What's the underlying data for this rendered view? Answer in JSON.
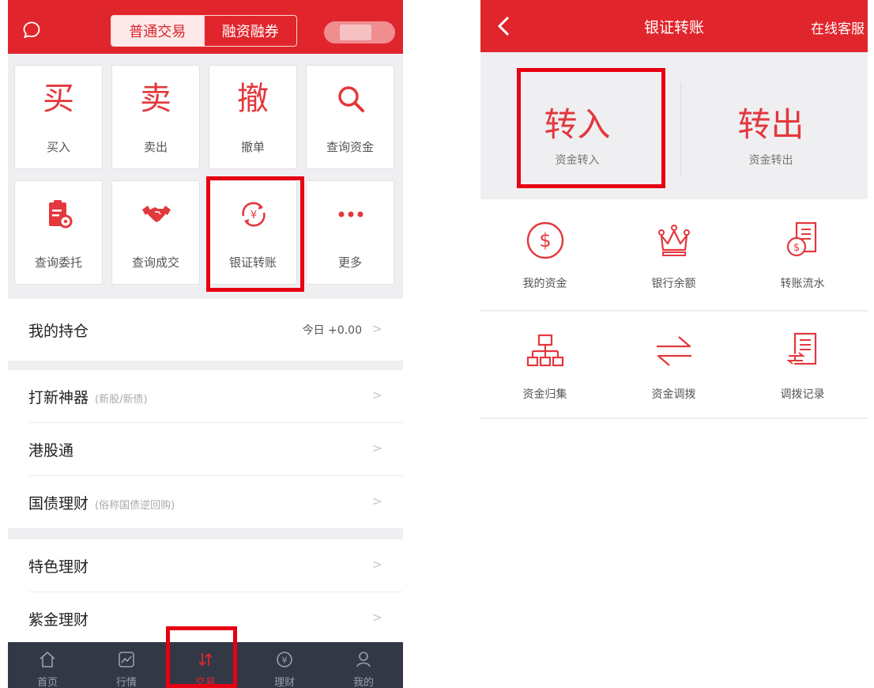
{
  "left": {
    "header": {
      "tabs": [
        "普通交易",
        "融资融券"
      ],
      "active_tab": 0
    },
    "grid": [
      {
        "glyph": "买",
        "label": "买入"
      },
      {
        "glyph": "卖",
        "label": "卖出"
      },
      {
        "glyph": "撤",
        "label": "撤单"
      },
      {
        "icon": "search-icon",
        "label": "查询资金"
      },
      {
        "icon": "clipboard-search-icon",
        "label": "查询委托"
      },
      {
        "icon": "handshake-icon",
        "label": "查询成交"
      },
      {
        "icon": "yuan-transfer-icon",
        "label": "银证转账"
      },
      {
        "icon": "more-dots-icon",
        "label": "更多"
      }
    ],
    "holdings": {
      "title": "我的持仓",
      "value": "今日 +0.00"
    },
    "list_group_1": [
      {
        "title": "打新神器",
        "subtitle": "(新股/新债)"
      },
      {
        "title": "港股通",
        "subtitle": ""
      },
      {
        "title": "国债理财",
        "subtitle": "(俗称国债逆回购)"
      }
    ],
    "list_group_2": [
      {
        "title": "特色理财"
      },
      {
        "title": "紫金理财"
      }
    ],
    "tabbar": [
      {
        "icon": "home-icon",
        "label": "首页"
      },
      {
        "icon": "chart-icon",
        "label": "行情"
      },
      {
        "icon": "trade-arrows-icon",
        "label": "交易"
      },
      {
        "icon": "yuan-circle-icon",
        "label": "理财"
      },
      {
        "icon": "user-icon",
        "label": "我的"
      }
    ],
    "active_tab_index": 2
  },
  "right": {
    "header": {
      "title": "银证转账",
      "action": "在线客服"
    },
    "transfer_in": {
      "title": "转入",
      "subtitle": "资金转入"
    },
    "transfer_out": {
      "title": "转出",
      "subtitle": "资金转出"
    },
    "functions": [
      {
        "icon": "dollar-circle-icon",
        "label": "我的资金"
      },
      {
        "icon": "crown-icon",
        "label": "银行余额"
      },
      {
        "icon": "statement-coin-icon",
        "label": "转账流水"
      },
      {
        "icon": "org-chart-icon",
        "label": "资金归集"
      },
      {
        "icon": "swap-arrows-icon",
        "label": "资金调拨"
      },
      {
        "icon": "transfer-record-icon",
        "label": "调拨记录"
      }
    ]
  },
  "colors": {
    "brand_red": "#e0262c",
    "highlight_red": "#e60012",
    "tabbar_bg": "#323846"
  }
}
